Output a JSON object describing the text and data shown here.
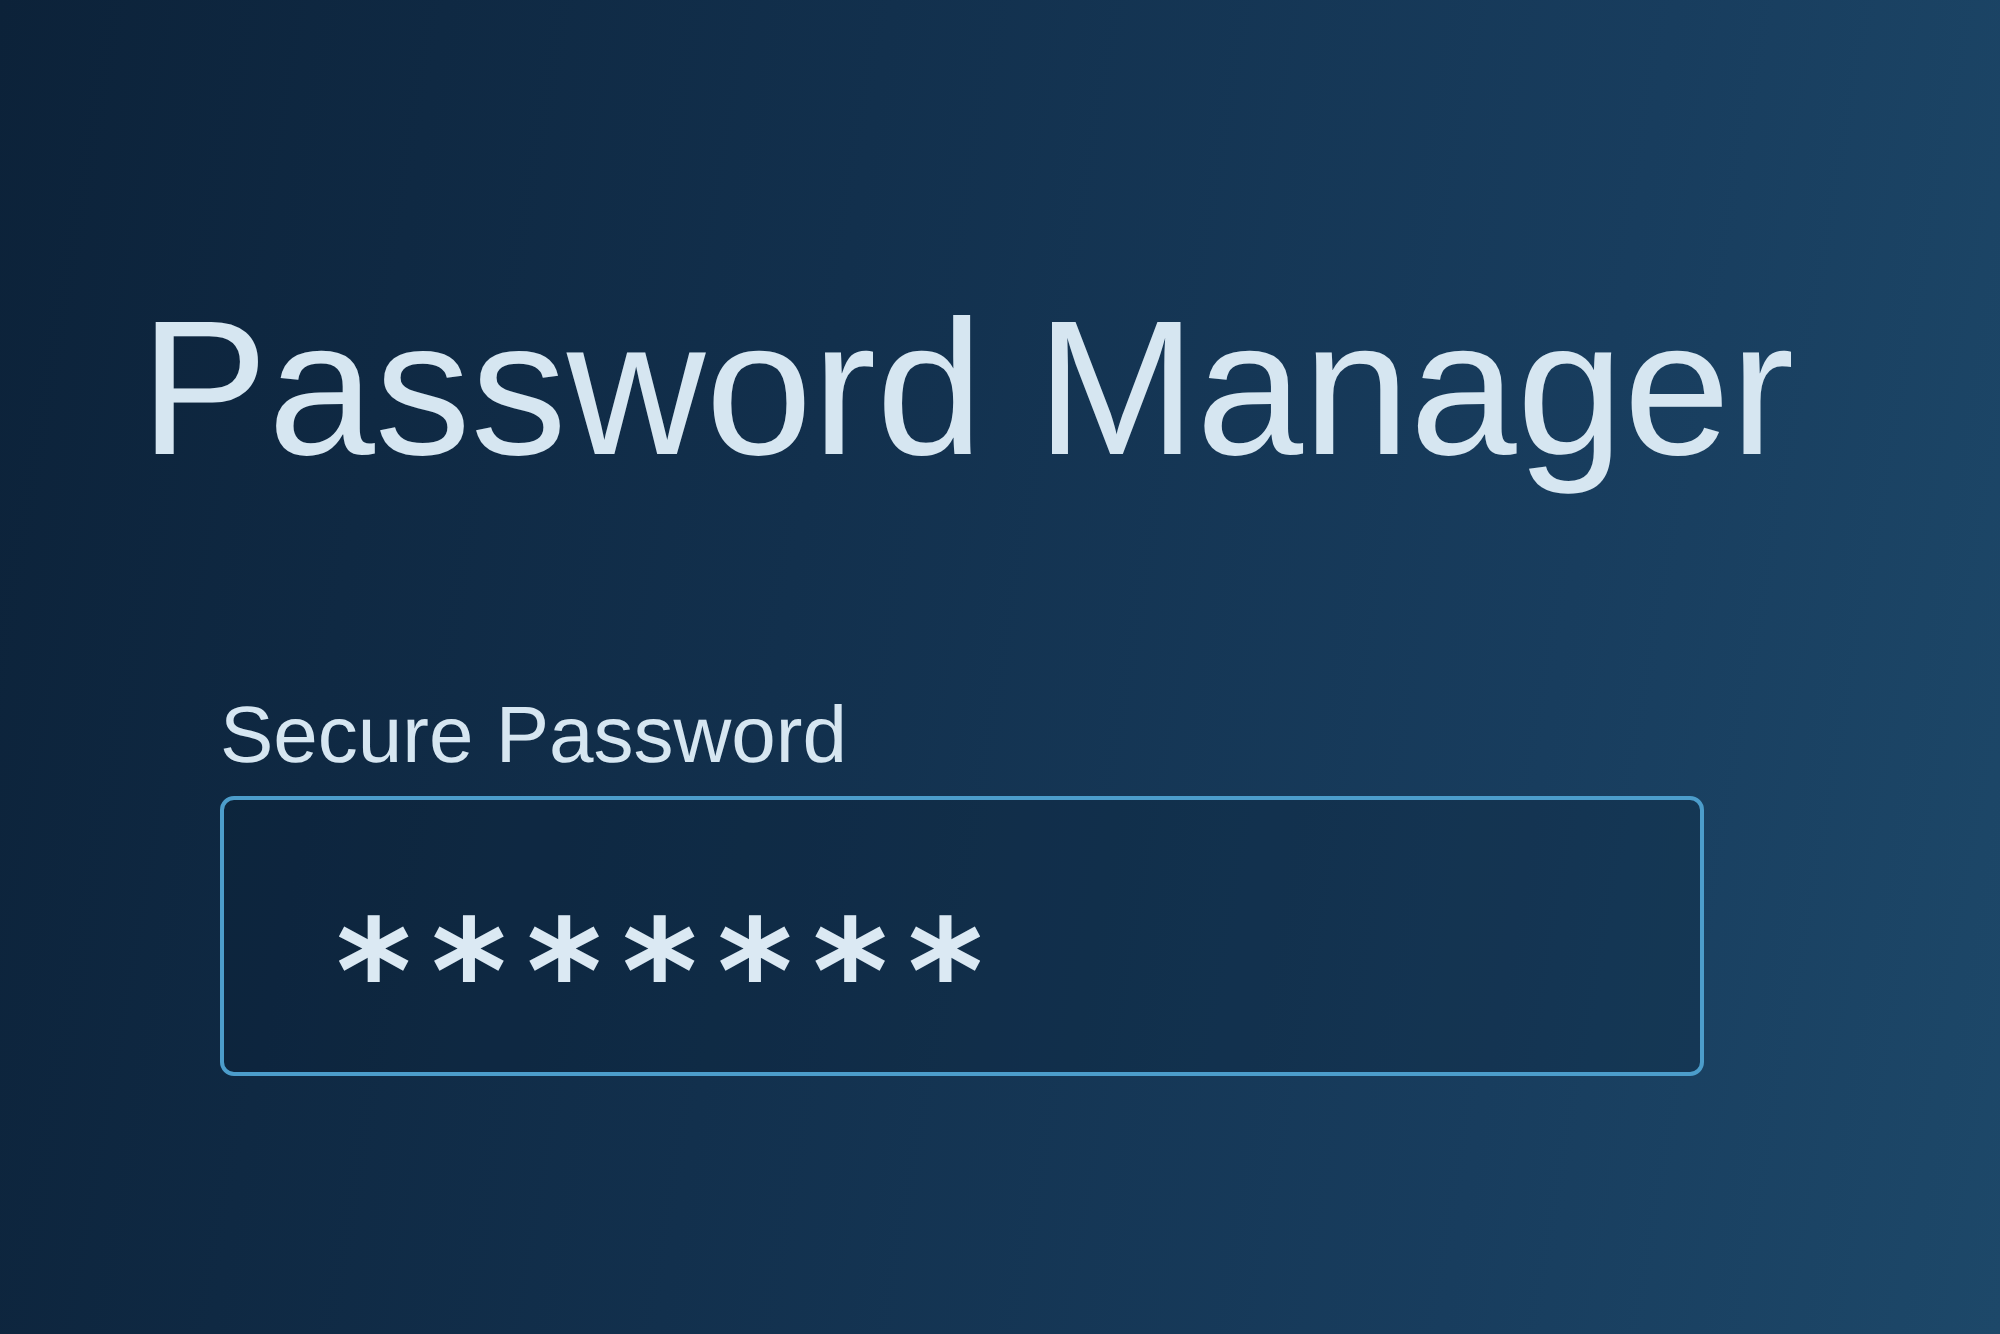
{
  "title": "Password Manager",
  "password_field": {
    "label": "Secure Password",
    "value": "*******"
  }
}
